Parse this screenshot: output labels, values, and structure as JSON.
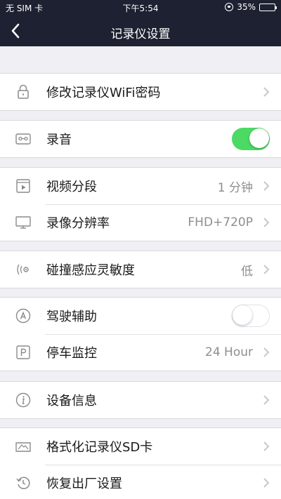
{
  "status_bar": {
    "carrier": "无 SIM 卡",
    "time": "下午5:54",
    "battery_percent_label": "35%",
    "battery_level": 0.35
  },
  "nav": {
    "title": "记录仪设置",
    "back_icon": "chevron-left-icon"
  },
  "sections": {
    "wifi": {
      "label": "修改记录仪WiFi密码",
      "icon": "lock-icon"
    },
    "audio": {
      "label": "录音",
      "icon": "cassette-icon",
      "toggle_on": true
    },
    "video_segment": {
      "label": "视频分段",
      "value": "1 分钟",
      "icon": "film-icon"
    },
    "resolution": {
      "label": "录像分辨率",
      "value": "FHD+720P",
      "icon": "monitor-icon"
    },
    "collision": {
      "label": "碰撞感应灵敏度",
      "value": "低",
      "icon": "sensor-icon"
    },
    "drive_assist": {
      "label": "驾驶辅助",
      "icon": "assist-a-icon",
      "toggle_on": false
    },
    "parking": {
      "label": "停车监控",
      "value": "24 Hour",
      "icon": "parking-p-icon"
    },
    "device_info": {
      "label": "设备信息",
      "icon": "info-icon"
    },
    "format_sd": {
      "label": "格式化记录仪SD卡",
      "icon": "sd-card-icon"
    },
    "factory_reset": {
      "label": "恢复出厂设置",
      "icon": "restore-icon"
    }
  },
  "colors": {
    "nav_bg": "#1e2131",
    "toggle_on": "#4cd964",
    "background": "#efeff4",
    "secondary_text": "#8e8e93"
  }
}
